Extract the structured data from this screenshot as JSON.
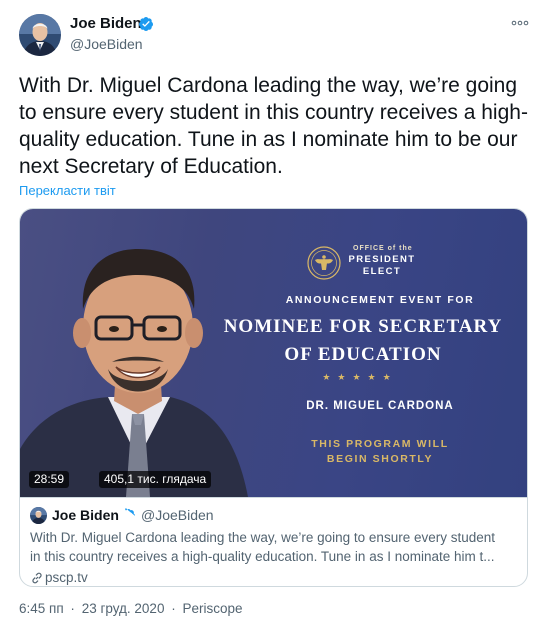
{
  "author": {
    "name": "Joe Biden",
    "handle": "@JoeBiden"
  },
  "tweet": {
    "text": "With Dr. Miguel Cardona leading the way, we’re going to ensure every student in this country receives a high-quality education. Tune in as I nominate him to be our next Secretary of Education.",
    "translate_label": "Перекласти твіт"
  },
  "media": {
    "office_small": "OFFICE of the",
    "office_big_1": "PRESIDENT",
    "office_big_2": "ELECT",
    "announcement": "ANNOUNCEMENT EVENT FOR",
    "title_1": "NOMINEE FOR SECRETARY",
    "title_2": "OF EDUCATION",
    "stars": "★★★★★",
    "nominee_name": "DR. MIGUEL CARDONA",
    "program_1": "THIS PROGRAM WILL",
    "program_2": "BEGIN SHORTLY",
    "duration": "28:59",
    "views": "405,1 тис. глядача"
  },
  "quote": {
    "name": "Joe Biden",
    "handle": "@JoeBiden",
    "text_1": "With Dr. Miguel Cardona leading the way, we’re going to ensure every student",
    "text_2": "in this country receives a high-quality education. Tune in as I nominate him t...",
    "link": "pscp.tv"
  },
  "meta": {
    "time": "6:45 пп",
    "date": "23 груд. 2020",
    "source": "Periscope",
    "separator": "·"
  },
  "colors": {
    "accent": "#1d9bf0",
    "secondary_text": "#536471",
    "gold": "#d9b866"
  },
  "icons": [
    "verified-icon",
    "more-icon",
    "link-icon",
    "presidential-seal-icon"
  ]
}
